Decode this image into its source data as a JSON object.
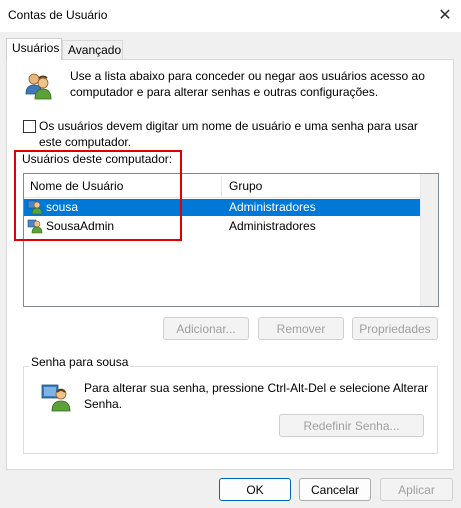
{
  "window": {
    "title": "Contas de Usuário"
  },
  "tabs": [
    {
      "label": "Usuários",
      "active": true
    },
    {
      "label": "Avançado",
      "active": false
    }
  ],
  "intro_text": "Use a lista abaixo para conceder ou negar aos usuários acesso ao computador e para alterar senhas e outras configurações.",
  "require_password": {
    "label": "Os usuários devem digitar um nome de usuário e uma senha para usar este computador.",
    "checked": false
  },
  "users_section": {
    "label": "Usuários deste computador:",
    "columns": [
      "Nome de Usuário",
      "Grupo"
    ],
    "rows": [
      {
        "name": "sousa",
        "group": "Administradores",
        "selected": true
      },
      {
        "name": "SousaAdmin",
        "group": "Administradores",
        "selected": false
      }
    ]
  },
  "user_buttons": {
    "add": "Adicionar...",
    "remove": "Remover",
    "properties": "Propriedades"
  },
  "password_group": {
    "label": "Senha para sousa",
    "text": "Para alterar sua senha, pressione Ctrl-Alt-Del e selecione Alterar Senha.",
    "reset_button": "Redefinir Senha..."
  },
  "dialog_buttons": {
    "ok": "OK",
    "cancel": "Cancelar",
    "apply": "Aplicar"
  },
  "colors": {
    "selection": "#0078d7",
    "highlight_box": "#e00000",
    "default_button_border": "#0067c0"
  },
  "icons": {
    "close": "close-icon",
    "users": "users-icon",
    "user_row": "user-icon",
    "password_user": "user-password-icon"
  }
}
